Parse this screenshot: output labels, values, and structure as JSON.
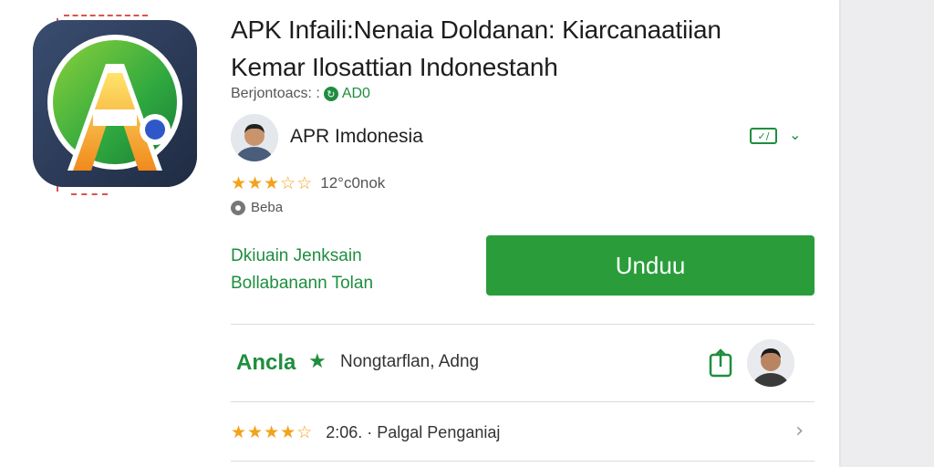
{
  "app": {
    "title_line1": "APK Infaili:Nenaia Doldanan: Kiarcanaatiian",
    "title_line2": "Kemar Ilosattian Indonestanh",
    "downloads_label": "Berjontoacs: :",
    "downloads_value": "AD0",
    "downloads_badge": "↻"
  },
  "developer": {
    "name": "APR Imdonesia",
    "verified_icon_text": "✓/",
    "chevron": "⌄"
  },
  "rating": {
    "stars_filled": 3,
    "stars_total": 5,
    "count": "12°c0nok"
  },
  "beta": {
    "label": "Beba"
  },
  "promo": {
    "line1": "Dkiuain Jenksain",
    "line2": "Bollabanann Tolan"
  },
  "download_button": {
    "label": "Unduu"
  },
  "section": {
    "title": "Ancla",
    "star": "★",
    "subtitle": "Nongtarflan, Adng"
  },
  "review": {
    "stars_filled": 4,
    "stars_total": 5,
    "text": "2:06. · Palgal Penganiaj",
    "chevron": "›"
  },
  "colors": {
    "accent_green": "#1e8e3e",
    "button_green": "#2a9d3a",
    "star_gold": "#f4a11c"
  },
  "icons": {
    "app_icon": "apk-logo-icon",
    "verified": "verified-badge-icon",
    "share": "share-icon"
  }
}
